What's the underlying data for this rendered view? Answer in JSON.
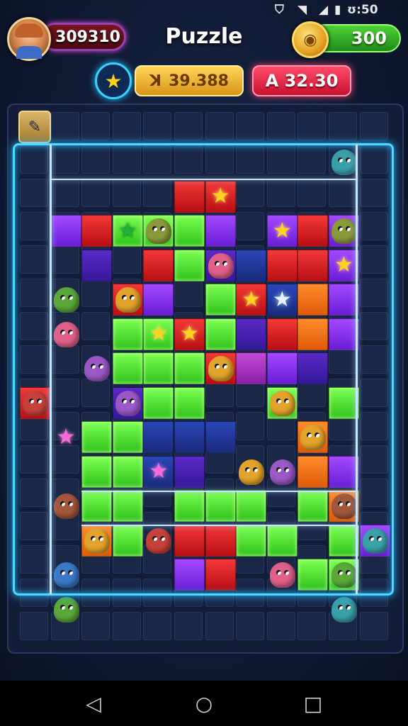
{
  "status_bar": {
    "time": "ʊ:50",
    "icons": [
      "vpn-icon",
      "wifi-icon",
      "signal-icon",
      "battery-icon"
    ]
  },
  "header": {
    "player_score": "309310",
    "title": "Puzzle",
    "coins": "300"
  },
  "stats": {
    "gold_value": "39.388",
    "red_value": "A 32.30"
  },
  "icons": {
    "star": "★",
    "gold_symbol": "ꓘ",
    "coin_symbol": "◉",
    "tool": "✎",
    "nav_back": "◁",
    "nav_home": "○",
    "nav_recent": "□"
  },
  "colors": {
    "neon_frame": "#4fd8ff",
    "green_tile": "#5aff3a",
    "red_tile": "#e52424",
    "purple_tile": "#8a35f0",
    "coin_pill": "#35b52a",
    "red_pill": "#e82a4a"
  }
}
